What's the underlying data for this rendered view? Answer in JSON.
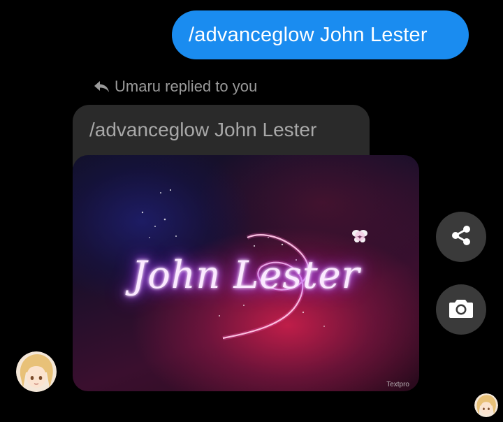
{
  "conversation": {
    "sent_message": "/advanceglow John Lester",
    "reply_indicator": {
      "icon": "reply-arrow-icon",
      "text": "Umaru replied to you"
    },
    "quoted_message": "/advanceglow John Lester",
    "image": {
      "glow_text": "John Lester",
      "watermark": "Textpro"
    },
    "actions": {
      "share_icon": "share-icon",
      "camera_icon": "camera-icon"
    }
  },
  "colors": {
    "sent_bubble": "#1a8cf0",
    "quoted_bubble": "#2a2a2a",
    "action_button": "#3a3a3a",
    "background": "#000000"
  }
}
